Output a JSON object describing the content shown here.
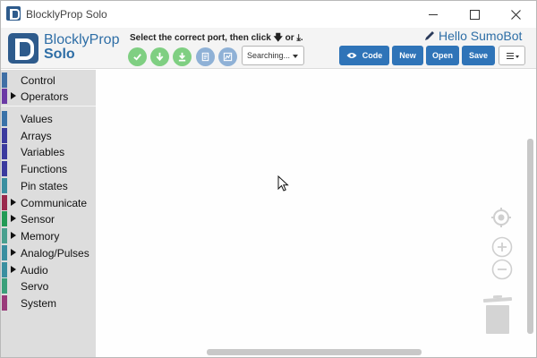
{
  "window": {
    "title": "BlocklyProp Solo",
    "controls": [
      "minimize-icon",
      "maximize-icon",
      "close-icon"
    ]
  },
  "brand": {
    "line1": "BlocklyProp",
    "line2": "Solo",
    "color": "#2e6ea6"
  },
  "toolbar": {
    "instruction_prefix": "Select the correct port, then click",
    "instruction_or": "or",
    "instruction_suffix": ".",
    "action_icons": [
      "verify-icon",
      "load-ram-icon",
      "load-eeprom-icon",
      "serial-terminal-icon",
      "graphing-icon"
    ],
    "port_value": "Searching...",
    "project_name": "Hello SumoBot",
    "code_label": "Code",
    "new_label": "New",
    "open_label": "Open",
    "save_label": "Save",
    "button_color": "#2f74b8",
    "green": "#7fcf82",
    "blue_gray": "#8fb1d6"
  },
  "sidebar": {
    "categories": [
      {
        "label": "Control",
        "color": "#3f6fa5",
        "expandable": false
      },
      {
        "label": "Operators",
        "color": "#6b3aa5",
        "expandable": true
      },
      {
        "label": "Values",
        "color": "#3a72a8",
        "expandable": false
      },
      {
        "label": "Arrays",
        "color": "#3b3a9e",
        "expandable": false
      },
      {
        "label": "Variables",
        "color": "#3b3a9e",
        "expandable": false
      },
      {
        "label": "Functions",
        "color": "#3b3a9e",
        "expandable": false
      },
      {
        "label": "Pin states",
        "color": "#3a8fa0",
        "expandable": false
      },
      {
        "label": "Communicate",
        "color": "#9a2a4c",
        "expandable": true
      },
      {
        "label": "Sensor",
        "color": "#239a55",
        "expandable": true
      },
      {
        "label": "Memory",
        "color": "#4aa08f",
        "expandable": true
      },
      {
        "label": "Analog/Pulses",
        "color": "#3a8fa0",
        "expandable": true
      },
      {
        "label": "Audio",
        "color": "#3a8fa0",
        "expandable": true
      },
      {
        "label": "Servo",
        "color": "#3aa07a",
        "expandable": false
      },
      {
        "label": "System",
        "color": "#9a3a7a",
        "expandable": false
      }
    ]
  },
  "workspace": {
    "tools": [
      "recenter-icon",
      "zoom-in-icon",
      "zoom-out-icon",
      "trash-icon"
    ]
  }
}
